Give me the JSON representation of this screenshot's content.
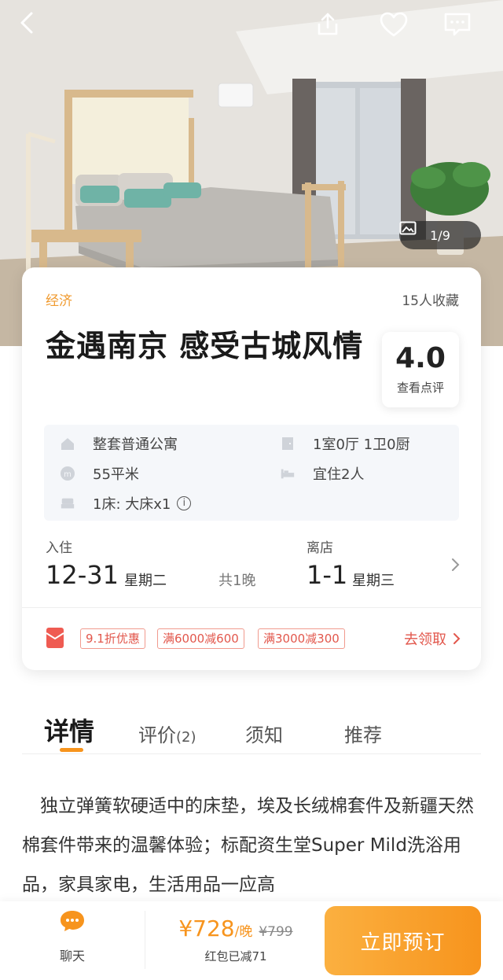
{
  "hero": {
    "photo_counter": "1/9",
    "icons": [
      "back-icon",
      "share-icon",
      "heart-icon",
      "message-icon",
      "image-icon"
    ]
  },
  "listing": {
    "category": "经济",
    "favorites": "15人收藏",
    "title": "金遇南京 感受古城风情",
    "rating": {
      "score": "4.0",
      "label": "查看点评"
    },
    "facts": [
      {
        "icon": "house-icon",
        "text": "整套普通公寓"
      },
      {
        "icon": "room-layout-icon",
        "text": "1室0厅 1卫0厨"
      },
      {
        "icon": "area-icon",
        "text": "55平米"
      },
      {
        "icon": "guests-icon",
        "text": "宜住2人"
      },
      {
        "icon": "bed-icon",
        "text": "1床: 大床x1"
      }
    ],
    "checkin": {
      "label": "入住",
      "date": "12-31",
      "weekday": "星期二"
    },
    "nights": "共1晚",
    "checkout": {
      "label": "离店",
      "date": "1-1",
      "weekday": "星期三"
    },
    "promo": {
      "coupons": [
        "9.1折优惠",
        "满6000减600",
        "满3000减300"
      ],
      "claim": "去领取"
    }
  },
  "tabs": [
    {
      "label": "详情",
      "active": true
    },
    {
      "label": "评价",
      "count": "(2)"
    },
    {
      "label": "须知"
    },
    {
      "label": "推荐"
    }
  ],
  "description": "独立弹簧软硬适中的床垫，埃及长绒棉套件及新疆天然棉套件带来的温馨体验；标配资生堂Super Mild洗浴用品，家具家电，生活用品一应高",
  "bottom_bar": {
    "chat_label": "聊天",
    "price": "¥728",
    "per_night": "/晚",
    "original_price": "¥799",
    "discount_note": "红包已减71",
    "book_button": "立即预订"
  },
  "colors": {
    "accent": "#f7941d",
    "promo_red": "#e2574c"
  }
}
